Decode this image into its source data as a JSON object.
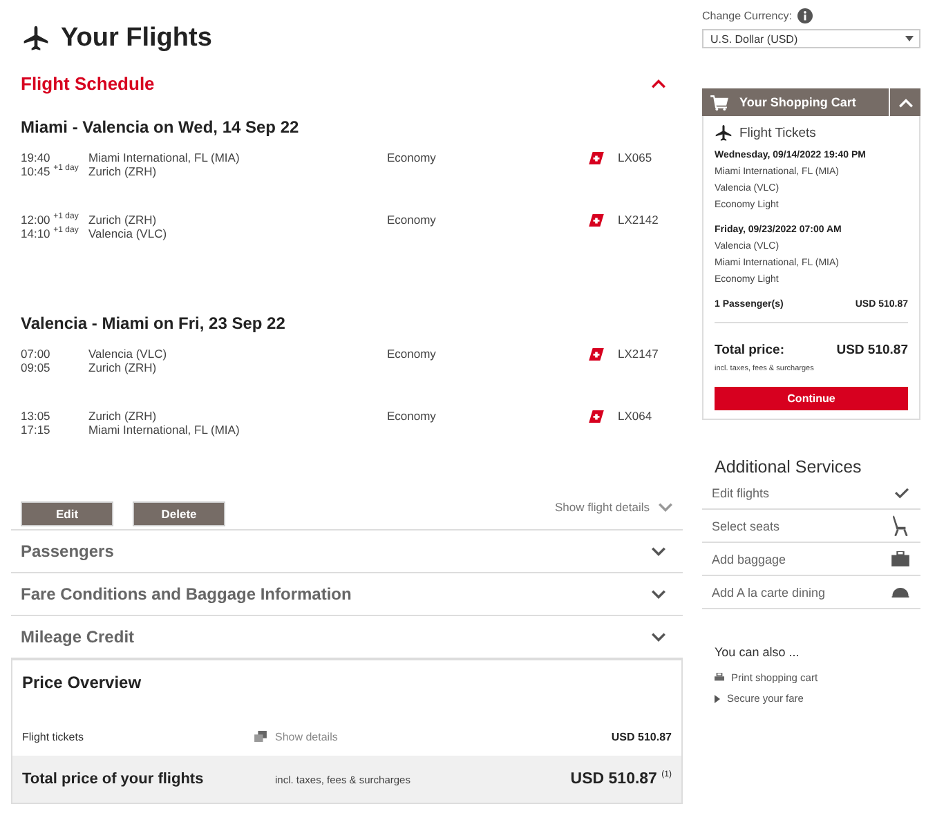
{
  "page_title": "Your Flights",
  "schedule": {
    "title": "Flight Schedule",
    "expanded": true,
    "journeys": [
      {
        "title": "Miami - Valencia on Wed, 14 Sep 22",
        "segments": [
          {
            "dep_time": "19:40",
            "arr_time": "10:45 $^{+1 day}$",
            "from": "Miami International, FL (MIA)",
            "to": "Zurich (ZRH)",
            "cabin": "Economy",
            "flight": "LX065"
          },
          {
            "dep_time": "12:00 $^{+1 day}$",
            "arr_time": "14:10 $^{+1 day}$",
            "from": "Zurich (ZRH)",
            "to": "Valencia (VLC)",
            "cabin": "Economy",
            "flight": "LX2142"
          }
        ]
      },
      {
        "title": "Valencia - Miami on Fri, 23 Sep 22",
        "segments": [
          {
            "dep_time": "07:00",
            "arr_time": "09:05",
            "from": "Valencia (VLC)",
            "to": "Zurich (ZRH)",
            "cabin": "Economy",
            "flight": "LX2147"
          },
          {
            "dep_time": "13:05",
            "arr_time": "17:15",
            "from": "Zurich (ZRH)",
            "to": "Miami International, FL (MIA)",
            "cabin": "Economy",
            "flight": "LX064"
          }
        ]
      }
    ],
    "buttons": [
      "Edit",
      "Delete"
    ],
    "details_link": "Show flight details"
  },
  "sections": [
    {
      "title": "Passengers",
      "expanded": false
    },
    {
      "title": "Fare Conditions and Baggage Information",
      "expanded": false
    },
    {
      "title": "Mileage Credit",
      "expanded": false
    }
  ],
  "price_overview": {
    "title": "Price Overview",
    "line": {
      "label": "Flight tickets",
      "link": "Show details",
      "amount": "USD 510.87"
    },
    "total": {
      "label": "Total price of your flights",
      "note": "incl. taxes, fees & surcharges",
      "amount": "USD 510.87 $^{(1)}$"
    }
  },
  "currency": {
    "label": "Change Currency:",
    "value": "U.S. Dollar (USD)"
  },
  "cart": {
    "title": "Your Shopping Cart",
    "expanded": true,
    "section": "Flight Tickets",
    "journeys": [
      {
        "heading": "Wednesday, 09/14/2022 19:40 PM",
        "lines": [
          "Miami International, FL (MIA)",
          "Valencia (VLC)",
          "Economy Light"
        ]
      },
      {
        "heading": "Friday, 09/23/2022 07:00 AM",
        "lines": [
          "Valencia (VLC)",
          "Miami International, FL (MIA)",
          "Economy Light"
        ]
      }
    ],
    "passengers": "1 Passenger(s)",
    "passengers_amount": "USD 510.87",
    "total_label": "Total price:",
    "total_amount": "USD 510.87",
    "total_note": "incl. taxes, fees & surcharges",
    "button": "Continue"
  },
  "services": {
    "title": "Additional Services",
    "items": [
      {
        "label": "Edit flights",
        "kind": "check"
      },
      {
        "label": "Select seats",
        "kind": "seat"
      },
      {
        "label": "Add baggage",
        "kind": "bag"
      },
      {
        "label": "Add A la carte dining",
        "kind": "dining"
      }
    ]
  },
  "also": {
    "title": "You can also ...",
    "links": [
      {
        "label": "Print shopping cart",
        "kind": "print"
      },
      {
        "label": "Secure your fare",
        "kind": "arrow"
      }
    ]
  }
}
